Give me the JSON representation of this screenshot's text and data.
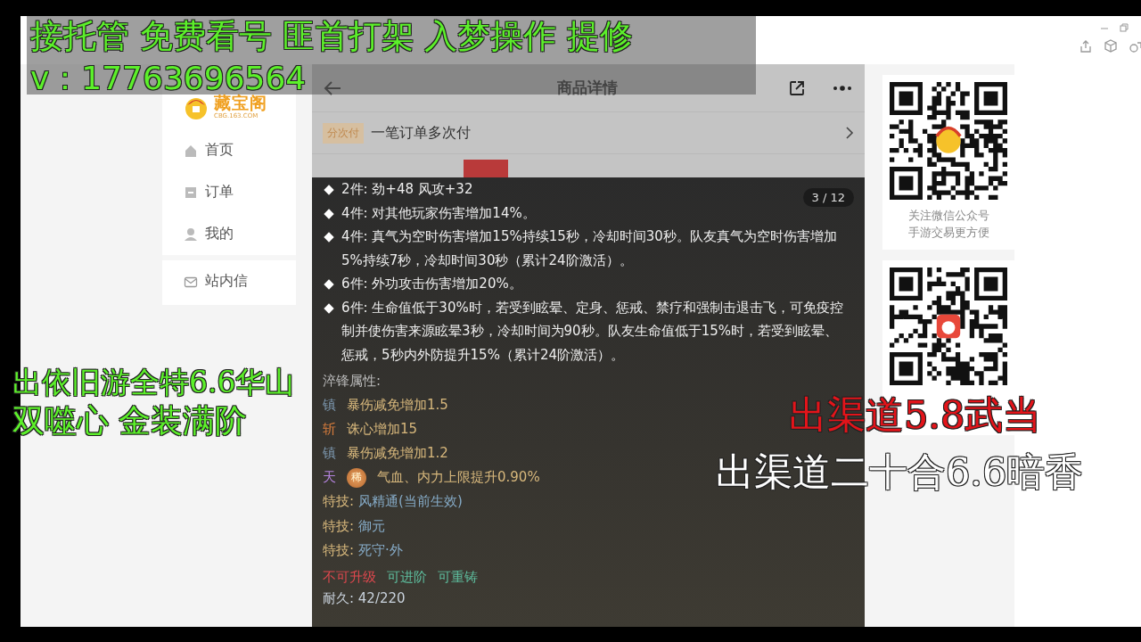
{
  "sidebar": {
    "logo_text": "藏宝阁",
    "logo_subtext": "CBG.163.COM",
    "items": [
      {
        "kind": "home",
        "label": "首页"
      },
      {
        "kind": "order",
        "label": "订单"
      },
      {
        "kind": "user",
        "label": "我的"
      },
      {
        "kind": "mail",
        "label": "站内信"
      }
    ]
  },
  "header": {
    "title": "商品详情"
  },
  "installment": {
    "tag": "分次付",
    "text": "一笔订单多次付"
  },
  "modal": {
    "counter": "3 / 12",
    "set_effects": [
      "2件: 劲+48 风攻+32",
      "4件: 对其他玩家伤害增加14%。",
      "4件: 真气为空时伤害增加15%持续15秒，冷却时间30秒。队友真气为空时伤害增加5%持续7秒，冷却时间30秒（累计24阶激活）。",
      "6件: 外功攻击伤害增加20%。",
      "6件: 生命值低于30%时，若受到眩晕、定身、惩戒、禁疗和强制击退击飞，可免疫控制并使伤害来源眩晕3秒，冷却时间为90秒。队友生命值低于15%时，若受到眩晕、惩戒，5秒内外防提升15%（累计24阶激活）。"
    ],
    "section_title": "淬锋属性:",
    "attributes": [
      {
        "prefix": "镇",
        "text": "暴伤减免增加1.5",
        "color": "#7f9bb3"
      },
      {
        "prefix": "斩",
        "text": "诛心增加15",
        "color": "#d27a3c"
      },
      {
        "prefix": "镇",
        "text": "暴伤减免增加1.2",
        "color": "#7f9bb3"
      },
      {
        "prefix": "天",
        "badge": "稀",
        "text": "气血、内力上限提升0.90%",
        "color": "#b383dd"
      }
    ],
    "skills": [
      {
        "label": "特技:",
        "value": "风精通(当前生效)"
      },
      {
        "label": "特技:",
        "value": "御元"
      },
      {
        "label": "特技:",
        "value": "死守·外"
      }
    ],
    "tags": [
      {
        "text": "不可升级",
        "color": "#e0484e"
      },
      {
        "text": "可进阶",
        "color": "#5ebf9f"
      },
      {
        "text": "可重铸",
        "color": "#5ebf9f"
      }
    ],
    "durability": "耐久: 42/220"
  },
  "qr_cards": [
    {
      "caption": [
        "关注微信公众号",
        "手游交易更方便"
      ],
      "kind": "wechat"
    },
    {
      "kind": "app"
    }
  ],
  "overlays": [
    {
      "text": "接托管 免费看号 匪首打架  入梦操作 提修",
      "color": "#5cf02a"
    },
    {
      "text": "v：17763696564",
      "color": "#5cf02a"
    },
    {
      "text": "出依旧游全特6.6华山",
      "color": "#5cf02a"
    },
    {
      "text": "双噬心 金装满阶",
      "color": "#5cf02a"
    },
    {
      "text": "出渠道5.8武当",
      "color": "#e3141a"
    },
    {
      "text": "出渠道二十合6.6暗香",
      "color": "#ffffff"
    }
  ]
}
